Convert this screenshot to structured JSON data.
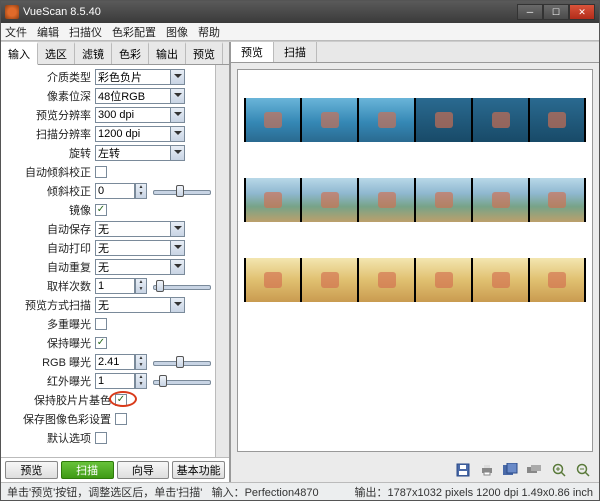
{
  "window": {
    "title": "VueScan 8.5.40"
  },
  "menu": [
    "文件",
    "编辑",
    "扫描仪",
    "色彩配置",
    "图像",
    "帮助"
  ],
  "leftTabs": [
    "输入",
    "选区",
    "滤镜",
    "色彩",
    "输出",
    "预览"
  ],
  "rightTabs": [
    "预览",
    "扫描"
  ],
  "options": {
    "mediaType": {
      "label": "介质类型",
      "value": "彩色负片"
    },
    "bitDepth": {
      "label": "像素位深",
      "value": "48位RGB"
    },
    "previewRes": {
      "label": "预览分辨率",
      "value": "300 dpi"
    },
    "scanRes": {
      "label": "扫描分辨率",
      "value": "1200 dpi"
    },
    "rotate": {
      "label": "旋转",
      "value": "左转"
    },
    "autoDeskew": {
      "label": "自动倾斜校正"
    },
    "deskew": {
      "label": "倾斜校正",
      "value": "0"
    },
    "mirror": {
      "label": "镜像"
    },
    "autoSave": {
      "label": "自动保存",
      "value": "无"
    },
    "autoPrint": {
      "label": "自动打印",
      "value": "无"
    },
    "autoRepeat": {
      "label": "自动重复",
      "value": "无"
    },
    "samples": {
      "label": "取样次数",
      "value": "1"
    },
    "previewScan": {
      "label": "预览方式扫描",
      "value": "无"
    },
    "multiExposure": {
      "label": "多重曝光"
    },
    "preserveExposure": {
      "label": "保持曝光"
    },
    "rgbExposure": {
      "label": "RGB 曝光",
      "value": "2.41"
    },
    "irExposure": {
      "label": "红外曝光",
      "value": "1"
    },
    "preserveBase": {
      "label": "保持胶片片基色"
    },
    "saveColorSettings": {
      "label": "保存图像色彩设置"
    },
    "defaultOptions": {
      "label": "默认选项"
    }
  },
  "buttons": {
    "preview": "预览",
    "scan": "扫描",
    "guide": "向导",
    "basic": "基本功能"
  },
  "status": {
    "left": "单击'预览'按钮，调整选区后，单击'扫描'",
    "mid": "输入：Perfection4870",
    "right": "输出：1787x1032 pixels 1200 dpi 1.49x0.86 inch"
  }
}
